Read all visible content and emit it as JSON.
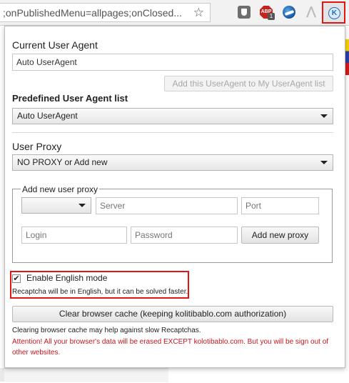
{
  "browser": {
    "url_text": ";onPublishedMenu=allpages;onClosed...",
    "icons": [
      "star-icon",
      "shield-extension-icon",
      "adblock-plus-icon",
      "globe-extension-icon",
      "pdf-extension-icon",
      "kolotibablo-extension-icon"
    ],
    "abp_label": "ABP",
    "abp_badge": "1",
    "k_label": "K",
    "pdf_glyph": "⋀"
  },
  "popup": {
    "current_ua": {
      "heading": "Current User Agent",
      "value": "Auto UserAgent",
      "add_button": "Add this UserAgent to My UserAgent list"
    },
    "predefined": {
      "heading": "Predefined User Agent list",
      "selected": "Auto UserAgent"
    },
    "proxy": {
      "heading": "User Proxy",
      "selected": "NO PROXY or Add new"
    },
    "new_proxy": {
      "legend": "Add new user proxy",
      "type_selected": "",
      "server_placeholder": "Server",
      "port_placeholder": "Port",
      "login_placeholder": "Login",
      "password_placeholder": "Password",
      "add_button": "Add new proxy"
    },
    "english_mode": {
      "checked": true,
      "label": "Enable English mode",
      "note": "Recaptcha will be in English, but it can be solved faster."
    },
    "cache": {
      "button": "Clear browser cache (keeping kolitibablo.com authorization)",
      "note": "Clearing browser cache may help against slow Recaptchas.",
      "warning": "Attention! All your browser's data will be erased EXCEPT kolotibablo.com. But you will be sign out of other websites."
    }
  },
  "colors": {
    "highlight": "#e01515",
    "warning": "#c4161c"
  }
}
